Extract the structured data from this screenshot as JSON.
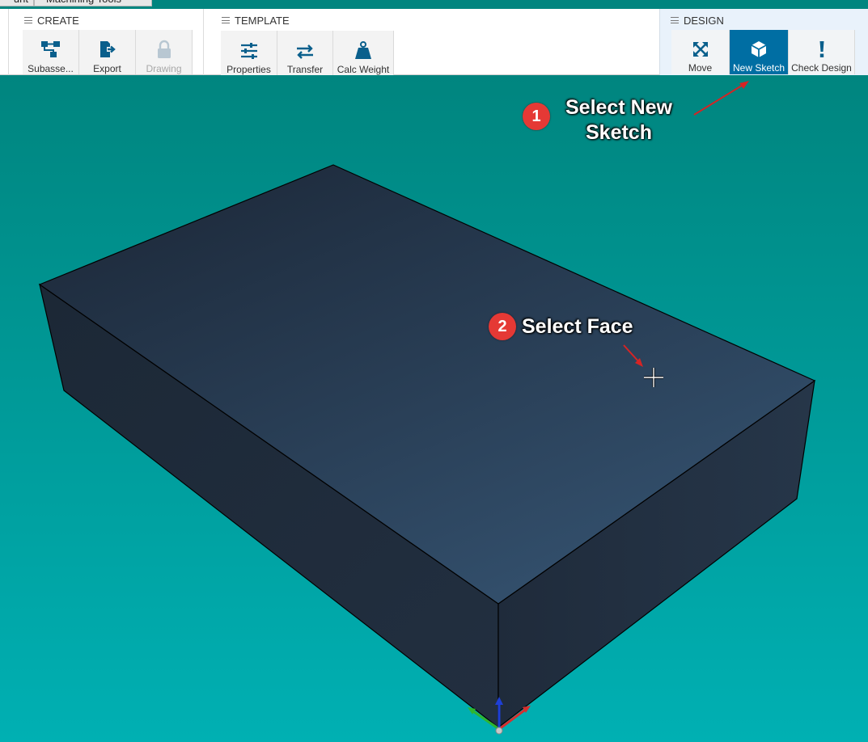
{
  "tabs": [
    {
      "label": "unt"
    },
    {
      "label": "Machining Tools"
    }
  ],
  "ribbon": {
    "create": {
      "title": "CREATE",
      "buttons": [
        {
          "label": "Subasse...",
          "icon": "hierarchy-icon"
        },
        {
          "label": "Export",
          "icon": "export-icon"
        },
        {
          "label": "Drawing",
          "icon": "lock-icon",
          "disabled": true
        }
      ]
    },
    "template": {
      "title": "TEMPLATE",
      "buttons": [
        {
          "label": "Properties",
          "icon": "sliders-icon"
        },
        {
          "label": "Transfer",
          "icon": "transfer-icon"
        },
        {
          "label": "Calc Weight",
          "icon": "weight-icon"
        }
      ]
    },
    "design": {
      "title": "DESIGN",
      "buttons": [
        {
          "label": "Move",
          "icon": "move-icon"
        },
        {
          "label": "New Sketch",
          "icon": "cube-icon",
          "active": true
        },
        {
          "label": "Check Design",
          "icon": "exclamation-icon"
        }
      ]
    }
  },
  "annotations": [
    {
      "number": "1",
      "text_line1": "Select New",
      "text_line2": "Sketch"
    },
    {
      "number": "2",
      "text": "Select Face"
    }
  ],
  "colors": {
    "accent": "#006ea3",
    "viewport_top": "#00857f",
    "viewport_bottom": "#00b0b3",
    "solid_top": "#2d4a66",
    "solid_side": "#1f2c3c",
    "badge": "#e53935"
  }
}
